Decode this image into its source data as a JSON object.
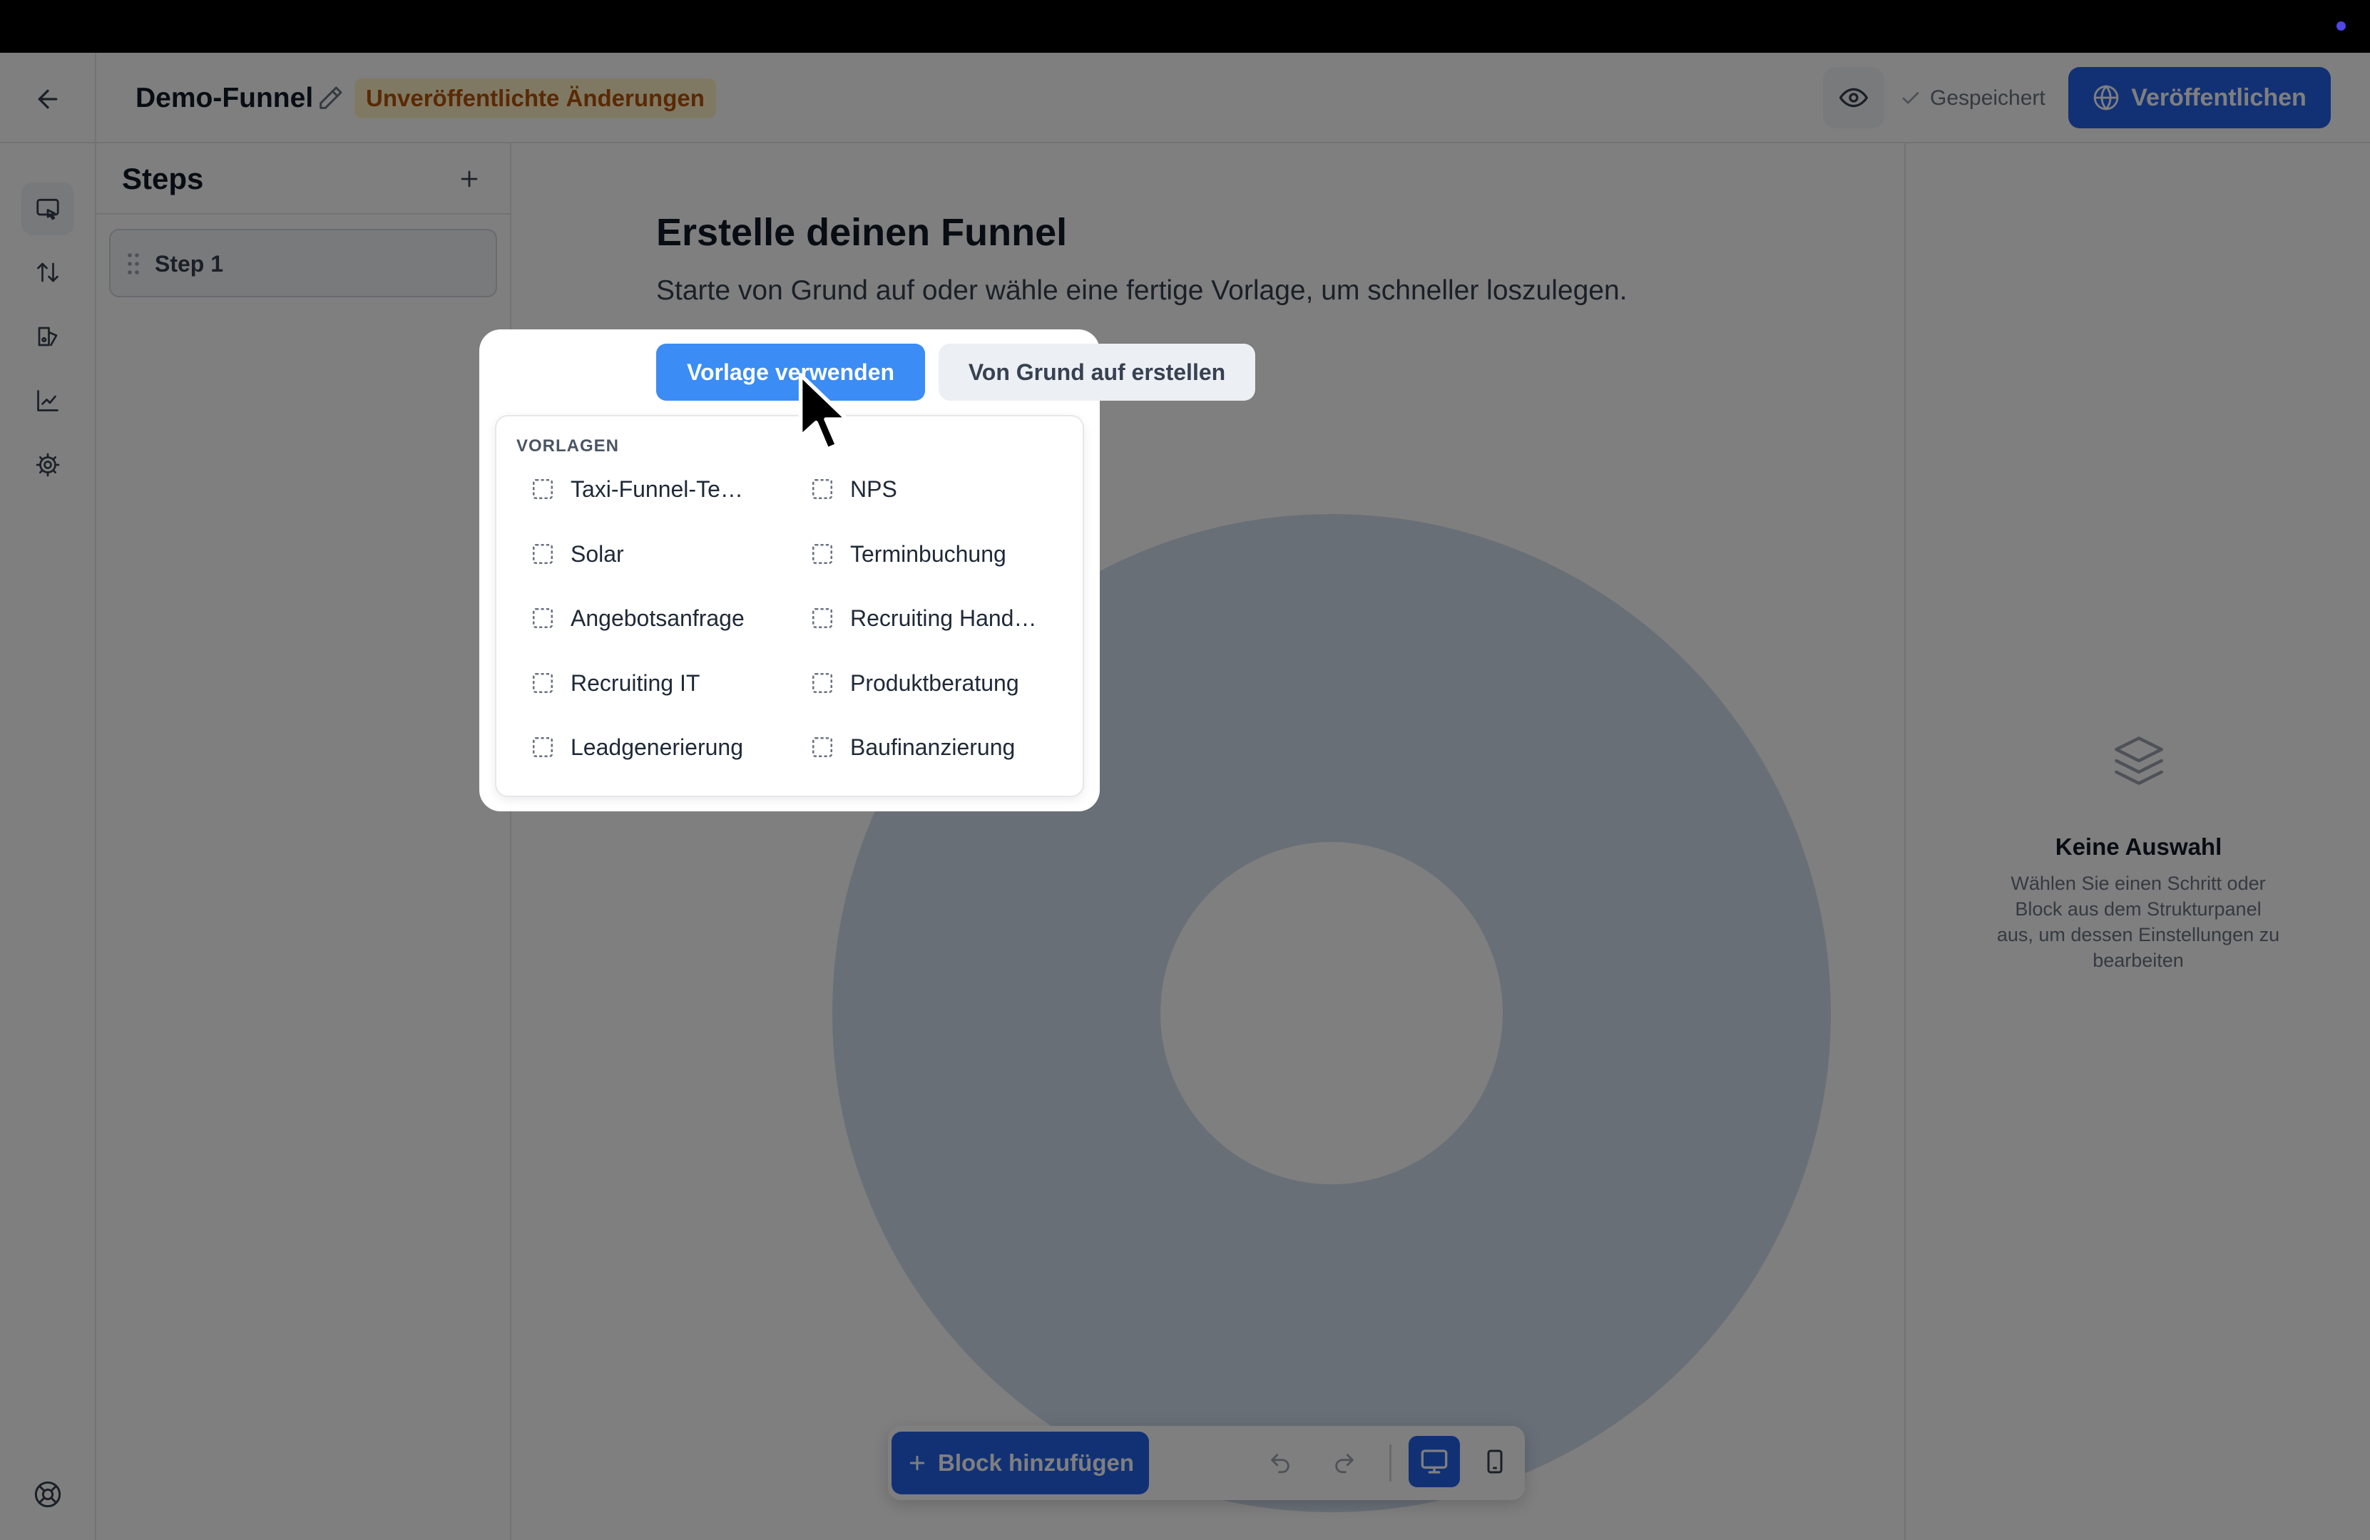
{
  "header": {
    "funnel_name": "Demo-Funnel",
    "unsaved_badge": "Unveröffentlichte Änderungen",
    "saved_label": "Gespeichert",
    "publish_label": "Veröffentlichen"
  },
  "rail": {
    "items": [
      "editor-icon",
      "sort-icon",
      "design-icon",
      "analytics-icon",
      "settings-icon"
    ],
    "bottom": "help-icon"
  },
  "steps": {
    "title": "Steps",
    "items": [
      {
        "label": "Step 1"
      }
    ]
  },
  "canvas": {
    "title": "Erstelle deinen Funnel",
    "subtitle": "Starte von Grund auf oder wähle eine fertige Vorlage, um schneller loszulegen.",
    "use_template_label": "Vorlage verwenden",
    "from_scratch_label": "Von Grund auf erstellen"
  },
  "template_menu": {
    "heading": "VORLAGEN",
    "templates": [
      "Taxi-Funnel-Te…",
      "NPS",
      "Solar",
      "Terminbuchung",
      "Angebotsanfrage",
      "Recruiting Hand…",
      "Recruiting IT",
      "Produktberatung",
      "Leadgenerierung",
      "Baufinanzierung"
    ]
  },
  "toolbar": {
    "add_block_label": "Block hinzufügen"
  },
  "inspector": {
    "empty_title": "Keine Auswahl",
    "empty_hint": "Wählen Sie einen Schritt oder Block aus dem Strukturpanel aus, um dessen Einstellungen zu bearbeiten"
  },
  "colors": {
    "primary": "#2563eb",
    "primary_light": "#3b8cf5",
    "badge_text": "#b45309",
    "badge_bg": "#fef3c7"
  }
}
